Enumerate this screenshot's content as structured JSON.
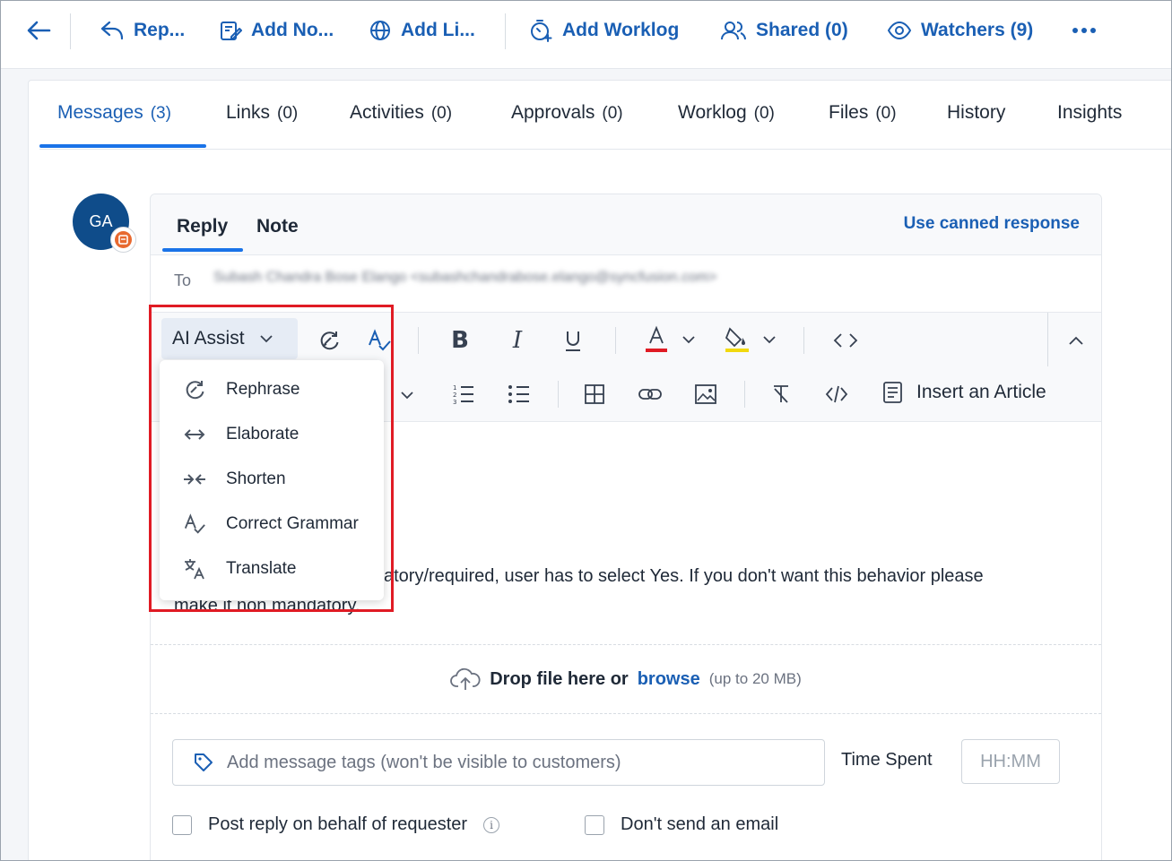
{
  "toolbar": {
    "back_label": "",
    "reply_label": "Rep...",
    "add_note_label": "Add No...",
    "add_link_label": "Add Li...",
    "add_worklog_label": "Add Worklog",
    "shared_label": "Shared (0)",
    "watchers_label": "Watchers (9)",
    "more_icon": "more-horizontal-icon",
    "accent_color": "#1a5fb4"
  },
  "tabs": [
    {
      "label": "Messages",
      "count": "(3)",
      "active": true
    },
    {
      "label": "Links",
      "count": "(0)"
    },
    {
      "label": "Activities",
      "count": "(0)"
    },
    {
      "label": "Approvals",
      "count": "(0)"
    },
    {
      "label": "Worklog",
      "count": "(0)"
    },
    {
      "label": "Files",
      "count": "(0)"
    },
    {
      "label": "History",
      "count": ""
    },
    {
      "label": "Insights",
      "count": ""
    }
  ],
  "avatar": {
    "initials": "GA",
    "bg_color": "#0f4c8a",
    "badge_color": "#e8692f"
  },
  "composer": {
    "tab_reply": "Reply",
    "tab_note": "Note",
    "canned_response": "Use canned response",
    "to_label": "To",
    "to_value": "Subash Chandra Bose Elango <subashchandrabose.elango@syncfusion.com>",
    "ai_assist_label": "AI Assist",
    "insert_article_label": "Insert an Article",
    "body_line1": "atory/required, user has to select Yes. If you don't want this behavior please",
    "body_line2": "make it non mandatory.",
    "drop_text": "Drop file here or",
    "browse_label": "browse",
    "size_limit": "(up to 20 MB)",
    "tags_placeholder": "Add message tags (won't be visible to customers)",
    "time_spent_label": "Time Spent",
    "time_placeholder": "HH:MM",
    "post_behalf_label": "Post reply on behalf of requester",
    "dont_send_label": "Don't send an email"
  },
  "ai_menu": {
    "items": [
      {
        "label": "Rephrase",
        "icon": "rephrase-icon"
      },
      {
        "label": "Elaborate",
        "icon": "elaborate-icon"
      },
      {
        "label": "Shorten",
        "icon": "shorten-icon"
      },
      {
        "label": "Correct Grammar",
        "icon": "grammar-icon"
      },
      {
        "label": "Translate",
        "icon": "translate-icon"
      }
    ],
    "highlight_color": "#e01b24"
  }
}
